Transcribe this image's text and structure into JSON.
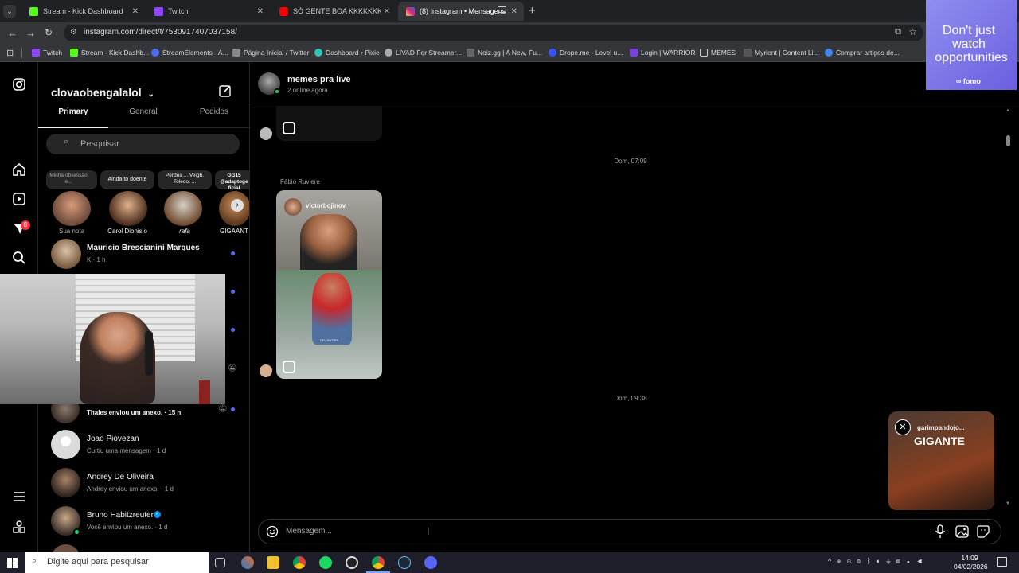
{
  "tabs": [
    {
      "title": "Stream - Kick Dashboard",
      "color": "#53fc18"
    },
    {
      "title": "Twitch",
      "color": "#9146ff"
    },
    {
      "title": "SÓ GENTE BOA KKKKKKKK - Yo",
      "color": "#ff0000"
    },
    {
      "title": "(8) Instagram • Mensagens",
      "color": "#d6249f"
    }
  ],
  "address": "instagram.com/direct/t/7530917407037158/",
  "bookmarks": [
    {
      "label": "Twitch",
      "color": "#9146ff"
    },
    {
      "label": "Stream - Kick Dashb...",
      "color": "#53fc18"
    },
    {
      "label": "StreamElements - A...",
      "color": "#4b6cf7"
    },
    {
      "label": "Página Inicial / Twitter",
      "color": "#888888"
    },
    {
      "label": "Dashboard • Pixie",
      "color": "#2ec4b6"
    },
    {
      "label": "LIVAD For Streamer...",
      "color": "#aaaaaa"
    },
    {
      "label": "Noiz.gg | A New, Fu...",
      "color": "#666666"
    },
    {
      "label": "Drope.me - Level u...",
      "color": "#3355ff"
    },
    {
      "label": "Login | WARRIOR",
      "color": "#7b3fe4"
    },
    {
      "label": "MEMES",
      "color": "#cccccc"
    },
    {
      "label": "Myrient | Content Li...",
      "color": "#555555"
    },
    {
      "label": "Comprar artigos de...",
      "color": "#4285f4"
    }
  ],
  "ad": {
    "line1": "Don't just",
    "line2": "watch",
    "line3": "opportunities",
    "brand": "fomo"
  },
  "inbox": {
    "username": "clovaobengalalol",
    "tabs": [
      "Primary",
      "General",
      "Pedidos"
    ],
    "search_placeholder": "Pesquisar",
    "notes": [
      {
        "bubble": "Minha obsessão é...",
        "name": "Sua nota"
      },
      {
        "bubble": "Ainda to doente",
        "name": "Carol Dionisio"
      },
      {
        "bubble": "Perdoa ... Veigh, Toledo, ...",
        "name": "rafa"
      },
      {
        "bubble": "GG15 @adaptoge ficial",
        "name": "GIGAANT"
      }
    ],
    "notification_count": "8",
    "chats": [
      {
        "name": "Mauricio Brescianini Marques",
        "sub": "K · 1 h"
      },
      {
        "name": "",
        "sub": "Thales enviou um anexo. · 15 h"
      },
      {
        "name": "Joao Piovezan",
        "sub": "Curtiu uma mensagem · 1 d"
      },
      {
        "name": "Andrey De Oliveira",
        "sub": "Andrey enviou um anexo. · 1 d"
      },
      {
        "name": "Bruno Habitzreuter",
        "sub": "Você enviou um anexo. · 1 d"
      }
    ]
  },
  "chat": {
    "title": "memes pra live",
    "status": "2 online agora",
    "time1": "Dom, 07:09",
    "sender": "Fábio Ruviere",
    "reel_user": "victorbojinov",
    "reel_caption": "DEL ENTIRE",
    "time2": "Dom, 09:38",
    "overlay_user": "garimpandojo...",
    "overlay_text": "GIGANTE",
    "composer_placeholder": "Mensagem..."
  },
  "taskbar": {
    "search": "Digite aqui para pesquisar",
    "time": "14:09",
    "date": "04/02/2026"
  }
}
